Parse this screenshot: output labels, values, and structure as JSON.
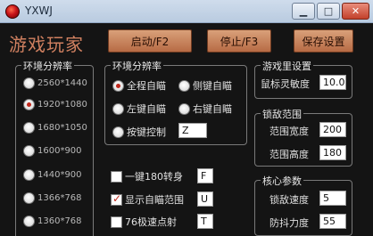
{
  "window": {
    "title": "YXWJ",
    "controls": {
      "minimize": "▁",
      "maximize": "□",
      "close": "✕"
    }
  },
  "header": {
    "app_title": "游戏玩家",
    "start_button": "启动/F2",
    "stop_button": "停止/F3",
    "save_button": "保存设置"
  },
  "resolution_group": {
    "label": "环境分辨率",
    "options": [
      {
        "label": "2560*1440",
        "selected": false
      },
      {
        "label": "1920*1080",
        "selected": true
      },
      {
        "label": "1680*1050",
        "selected": false
      },
      {
        "label": "1600*900",
        "selected": false
      },
      {
        "label": "1440*900",
        "selected": false
      },
      {
        "label": "1366*768",
        "selected": false
      },
      {
        "label": "1360*768",
        "selected": false
      }
    ]
  },
  "aim_group": {
    "label": "环境分辨率",
    "options": {
      "full_auto": {
        "label": "全程自瞄",
        "selected": true
      },
      "side_key": {
        "label": "侧键自瞄",
        "selected": false
      },
      "left_key": {
        "label": "左键自瞄",
        "selected": false
      },
      "right_key": {
        "label": "右键自瞄",
        "selected": false
      },
      "key_control": {
        "label": "按键控制",
        "selected": false
      }
    },
    "key_control_value": "Z"
  },
  "toggles": {
    "quick_turn": {
      "label": "一键180转身",
      "checked": false,
      "key": "F"
    },
    "show_range": {
      "label": "显示自瞄范围",
      "checked": true,
      "key": "U"
    },
    "rapid_fire": {
      "label": "76极速点射",
      "checked": false,
      "key": "T"
    }
  },
  "game_settings": {
    "label": "游戏里设置",
    "mouse_sensitivity_label": "鼠标灵敏度",
    "mouse_sensitivity": "10.0"
  },
  "lock_range": {
    "label": "锁敌范围",
    "width_label": "范围宽度",
    "width": "200",
    "height_label": "范围高度",
    "height": "180"
  },
  "core_params": {
    "label": "核心参数",
    "lock_speed_label": "锁敌速度",
    "lock_speed": "5",
    "recoil_label": "防抖力度",
    "recoil": "55"
  }
}
